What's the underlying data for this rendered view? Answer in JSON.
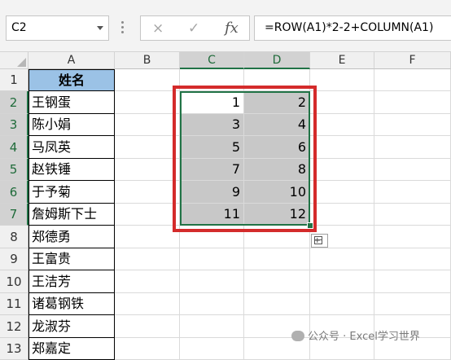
{
  "namebox": {
    "value": "C2"
  },
  "formula_bar": {
    "cancel_icon": "×",
    "enter_icon": "✓",
    "insert_function_icon": "fx",
    "formula": "=ROW(A1)*2-2+COLUMN(A1)"
  },
  "columns": [
    "A",
    "B",
    "C",
    "D",
    "E",
    "F"
  ],
  "rows": [
    "1",
    "2",
    "3",
    "4",
    "5",
    "6",
    "7",
    "8",
    "9",
    "10",
    "11",
    "12",
    "13"
  ],
  "column_a": [
    "姓名",
    "王钢蛋",
    "陈小娟",
    "马凤英",
    "赵铁锤",
    "于予菊",
    "詹姆斯下士",
    "郑德勇",
    "王富贵",
    "王洁芳",
    "诸葛钢铁",
    "龙淑芬",
    "郑嘉定"
  ],
  "column_c": [
    "1",
    "3",
    "5",
    "7",
    "9",
    "11"
  ],
  "column_d": [
    "2",
    "4",
    "6",
    "8",
    "10",
    "12"
  ],
  "selected_columns": [
    "C",
    "D"
  ],
  "selected_rows": [
    "2",
    "3",
    "4",
    "5",
    "6",
    "7"
  ],
  "colors": {
    "header_fill": "#9bc2e6",
    "highlight_border": "#d42b2b",
    "selection": "#217346"
  },
  "watermark": "公众号 · Excel学习世界"
}
